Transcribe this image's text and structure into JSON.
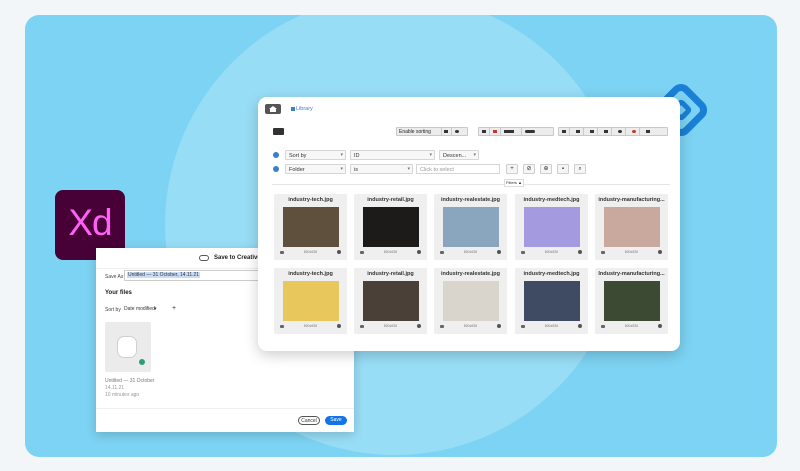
{
  "xd_logo": {
    "text": "Xd",
    "color_bg": "#470137",
    "color_fg": "#ff61f6"
  },
  "creative_cloud": {
    "title": "Save to Creative Cloud",
    "save_as_label": "Save As",
    "file_name_value": "Untitled — 31 October, 14.11.21",
    "your_files": "Your files",
    "sort_by_label": "Sort by",
    "sort_by_value": "Date modified",
    "add_icon": "+",
    "recent_file": {
      "name": "Untitled — 31 October",
      "size": "14.11.21",
      "modified": "10 minutes ago"
    },
    "cancel_label": "Cancel",
    "save_label": "Save"
  },
  "library": {
    "tab": "Library",
    "toolbar": {
      "enable_sorting": "Enable sorting"
    },
    "filter_rows": [
      {
        "field": "Sort by",
        "operator": "ID",
        "value": "Descen..."
      },
      {
        "field": "Folder",
        "operator": "is",
        "placeholder": "Click to select"
      }
    ],
    "filters_toggle": "Filters ▲",
    "files": [
      {
        "name": "industry-tech.jpg",
        "size": "800x530",
        "color": "#5f4f3d"
      },
      {
        "name": "industry-retail.jpg",
        "size": "800x530",
        "color": "#1c1b19"
      },
      {
        "name": "industry-realestate.jpg",
        "size": "800x530",
        "color": "#8aa6bf"
      },
      {
        "name": "industry-medtech.jpg",
        "size": "800x530",
        "color": "#a39ae0"
      },
      {
        "name": "industry-manufacturing...",
        "size": "800x530",
        "color": "#c9a99e"
      },
      {
        "name": "industry-tech.jpg",
        "size": "800x530",
        "color": "#e8c85d"
      },
      {
        "name": "industry-retail.jpg",
        "size": "800x530",
        "color": "#4b4037"
      },
      {
        "name": "industry-realestate.jpg",
        "size": "800x530",
        "color": "#d9d5cc"
      },
      {
        "name": "industry-medtech.jpg",
        "size": "800x530",
        "color": "#3f4b62"
      },
      {
        "name": "Industry-manufacturing...",
        "size": "800x530",
        "color": "#3d4a33"
      }
    ]
  },
  "colors": {
    "banner": "#7dd3f3",
    "accent": "#3c7ec9",
    "save_button": "#1473e6"
  }
}
